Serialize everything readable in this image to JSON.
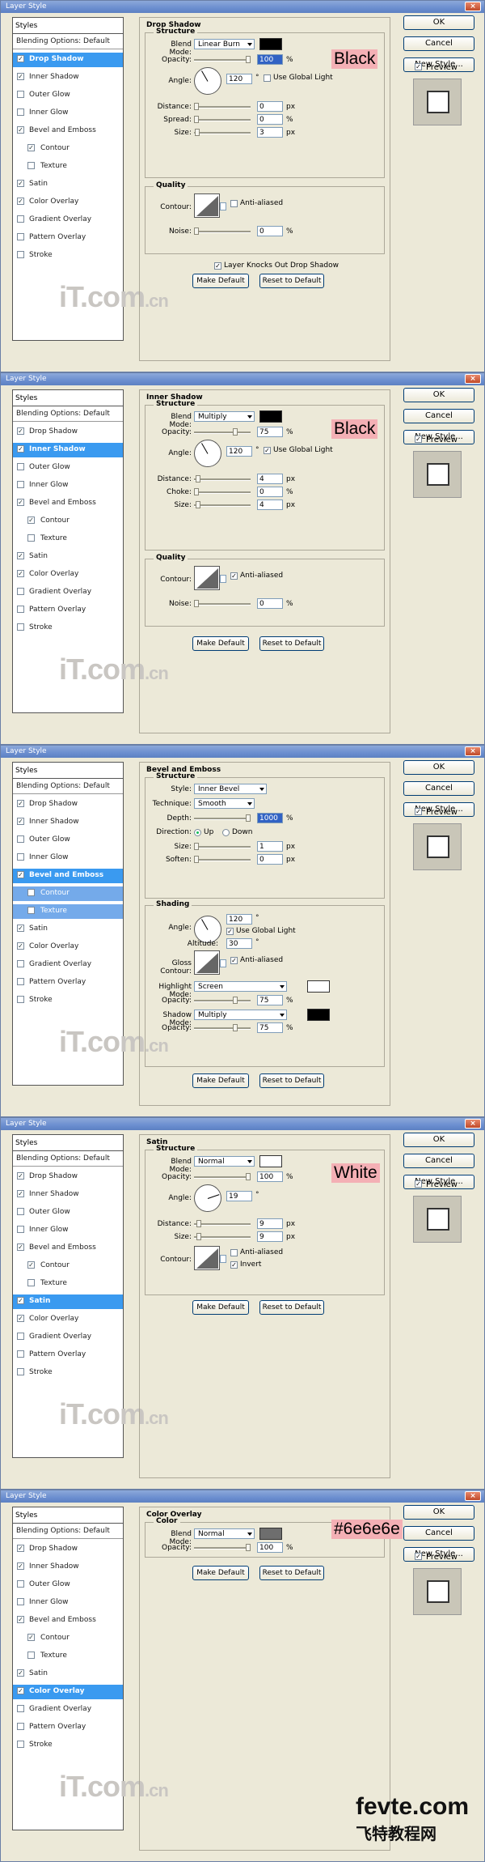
{
  "window_title": "Layer Style",
  "buttons": {
    "ok": "OK",
    "cancel": "Cancel",
    "new_style": "New Style...",
    "preview": "Preview"
  },
  "styles_header": "Styles",
  "style_items": [
    "Blending Options: Default",
    "Drop Shadow",
    "Inner Shadow",
    "Outer Glow",
    "Inner Glow",
    "Bevel and Emboss",
    "Contour",
    "Texture",
    "Satin",
    "Color Overlay",
    "Gradient Overlay",
    "Pattern Overlay",
    "Stroke"
  ],
  "common": {
    "make_default": "Make Default",
    "reset_default": "Reset to Default"
  },
  "watermark": {
    "main": "iT.com",
    "dot_cn": ".cn"
  },
  "footer": {
    "brand": "fevte.com",
    "chinese": "飞特教程网"
  },
  "drop_shadow": {
    "title": "Drop Shadow",
    "structure": "Structure",
    "quality": "Quality",
    "blend_mode_label": "Blend Mode:",
    "blend_mode": "Linear Burn",
    "color": "#000000",
    "annotation": "Black",
    "opacity_label": "Opacity:",
    "opacity": "100",
    "angle_label": "Angle:",
    "angle": "120",
    "use_global_light": "Use Global Light",
    "distance_label": "Distance:",
    "distance": "0",
    "spread_label": "Spread:",
    "spread": "0",
    "size_label": "Size:",
    "size": "3",
    "contour_label": "Contour:",
    "anti_aliased": "Anti-aliased",
    "noise_label": "Noise:",
    "noise": "0",
    "knockout": "Layer Knocks Out Drop Shadow",
    "px": "px",
    "pct": "%",
    "deg": "°"
  },
  "inner_shadow": {
    "title": "Inner Shadow",
    "structure": "Structure",
    "quality": "Quality",
    "blend_mode_label": "Blend Mode:",
    "blend_mode": "Multiply",
    "color": "#000000",
    "annotation": "Black",
    "opacity_label": "Opacity:",
    "opacity": "75",
    "angle_label": "Angle:",
    "angle": "120",
    "use_global_light": "Use Global Light",
    "distance_label": "Distance:",
    "distance": "4",
    "choke_label": "Choke:",
    "choke": "0",
    "size_label": "Size:",
    "size": "4",
    "contour_label": "Contour:",
    "anti_aliased": "Anti-aliased",
    "noise_label": "Noise:",
    "noise": "0",
    "px": "px",
    "pct": "%",
    "deg": "°"
  },
  "bevel": {
    "title": "Bevel and Emboss",
    "structure": "Structure",
    "shading": "Shading",
    "style_label": "Style:",
    "style": "Inner Bevel",
    "technique_label": "Technique:",
    "technique": "Smooth",
    "depth_label": "Depth:",
    "depth": "1000",
    "direction_label": "Direction:",
    "up": "Up",
    "down": "Down",
    "size_label": "Size:",
    "size": "1",
    "soften_label": "Soften:",
    "soften": "0",
    "angle_label": "Angle:",
    "angle": "120",
    "use_global_light": "Use Global Light",
    "altitude_label": "Altitude:",
    "altitude": "30",
    "gloss_label": "Gloss Contour:",
    "anti_aliased": "Anti-aliased",
    "highlight_label": "Highlight Mode:",
    "highlight_mode": "Screen",
    "highlight_color": "#ffffff",
    "hopacity_label": "Opacity:",
    "hopacity": "75",
    "shadow_label": "Shadow Mode:",
    "shadow_mode": "Multiply",
    "shadow_color": "#000000",
    "sopacity_label": "Opacity:",
    "sopacity": "75",
    "px": "px",
    "pct": "%",
    "deg": "°"
  },
  "satin": {
    "title": "Satin",
    "structure": "Structure",
    "blend_mode_label": "Blend Mode:",
    "blend_mode": "Normal",
    "color": "#ffffff",
    "annotation": "White",
    "opacity_label": "Opacity:",
    "opacity": "100",
    "angle_label": "Angle:",
    "angle": "19",
    "distance_label": "Distance:",
    "distance": "9",
    "size_label": "Size:",
    "size": "9",
    "contour_label": "Contour:",
    "anti_aliased": "Anti-aliased",
    "invert": "Invert",
    "px": "px",
    "pct": "%",
    "deg": "°"
  },
  "color_overlay": {
    "title": "Color Overlay",
    "color_group": "Color",
    "blend_mode_label": "Blend Mode:",
    "blend_mode": "Normal",
    "color": "#6e6e6e",
    "annotation": "#6e6e6e",
    "opacity_label": "Opacity:",
    "opacity": "100",
    "pct": "%"
  }
}
